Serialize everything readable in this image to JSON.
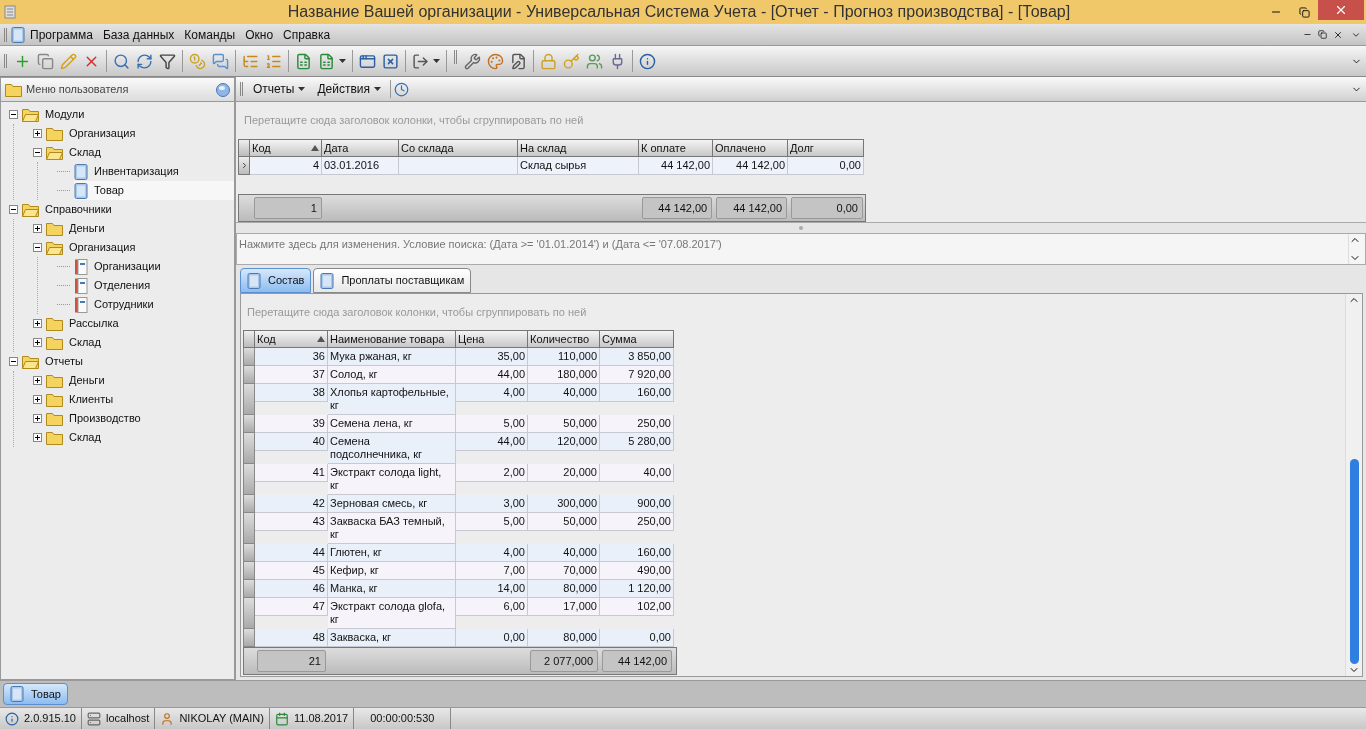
{
  "window": {
    "title": "Название Вашей организации - Универсальная Система Учета - [Отчет - Прогноз производства] - [Товар]"
  },
  "menu": [
    "Программа",
    "База данных",
    "Команды",
    "Окно",
    "Справка"
  ],
  "sidebar": {
    "title": "Меню пользователя",
    "tree": [
      {
        "label": "Модули",
        "kind": "folder",
        "expanded": true,
        "selected": false,
        "children": [
          {
            "label": "Организация",
            "kind": "folder",
            "expanded": false,
            "selected": false
          },
          {
            "label": "Склад",
            "kind": "folder",
            "expanded": true,
            "selected": false,
            "children": [
              {
                "label": "Инвентаризация",
                "kind": "form",
                "selected": false
              },
              {
                "label": "Товар",
                "kind": "form",
                "selected": true
              }
            ]
          }
        ]
      },
      {
        "label": "Справочники",
        "kind": "folder",
        "expanded": true,
        "selected": false,
        "children": [
          {
            "label": "Деньги",
            "kind": "folder",
            "expanded": false,
            "selected": false
          },
          {
            "label": "Организация",
            "kind": "folder",
            "expanded": true,
            "selected": false,
            "children": [
              {
                "label": "Организации",
                "kind": "list",
                "selected": false
              },
              {
                "label": "Отделения",
                "kind": "list",
                "selected": false
              },
              {
                "label": "Сотрудники",
                "kind": "list",
                "selected": false
              }
            ]
          },
          {
            "label": "Рассылка",
            "kind": "folder",
            "expanded": false,
            "selected": false
          },
          {
            "label": "Склад",
            "kind": "folder",
            "expanded": false,
            "selected": false
          }
        ]
      },
      {
        "label": "Отчеты",
        "kind": "folder",
        "expanded": true,
        "selected": false,
        "children": [
          {
            "label": "Деньги",
            "kind": "folder",
            "expanded": false,
            "selected": false
          },
          {
            "label": "Клиенты",
            "kind": "folder",
            "expanded": false,
            "selected": false
          },
          {
            "label": "Производство",
            "kind": "folder",
            "expanded": false,
            "selected": false
          },
          {
            "label": "Склад",
            "kind": "folder",
            "expanded": false,
            "selected": false
          }
        ]
      }
    ]
  },
  "report_toolbar": [
    "Отчеты",
    "Действия"
  ],
  "upper_grid": {
    "group_hint": "Перетащите сюда заголовок колонки, чтобы сгруппировать по ней",
    "columns": [
      {
        "label": "Код",
        "sorted": true
      },
      {
        "label": "Дата",
        "sorted": false
      },
      {
        "label": "Со склада",
        "sorted": false
      },
      {
        "label": "На склад",
        "sorted": false
      },
      {
        "label": "К оплате",
        "sorted": false
      },
      {
        "label": "Оплачено",
        "sorted": false
      },
      {
        "label": "Долг",
        "sorted": false
      }
    ],
    "rows": [
      {
        "selected": true,
        "cells": [
          "4",
          "03.01.2016",
          "",
          "Склад сырья",
          "44 142,00",
          "44 142,00",
          "0,00"
        ]
      }
    ],
    "totals": {
      "count": "1",
      "sums": [
        "44 142,00",
        "44 142,00",
        "0,00"
      ]
    }
  },
  "filter": "Нажмите здесь для изменения. Условие поиска: (Дата  >= '01.01.2014') и (Дата  <= '07.08.2017')",
  "tabs": [
    {
      "label": "Состав",
      "selected": true
    },
    {
      "label": "Проплаты поставщикам",
      "selected": false
    }
  ],
  "lower_grid": {
    "group_hint": "Перетащите сюда заголовок колонки, чтобы сгруппировать по ней",
    "columns": [
      {
        "label": "Код",
        "sorted": true
      },
      {
        "label": "Наименование товара",
        "sorted": false
      },
      {
        "label": "Цена",
        "sorted": false
      },
      {
        "label": "Количество",
        "sorted": false
      },
      {
        "label": "Сумма",
        "sorted": false
      }
    ],
    "rows": [
      [
        "36",
        "Мука ржаная, кг",
        "35,00",
        "110,000",
        "3 850,00"
      ],
      [
        "37",
        "Солод, кг",
        "44,00",
        "180,000",
        "7 920,00"
      ],
      [
        "38",
        "Хлопья картофельные, кг",
        "4,00",
        "40,000",
        "160,00"
      ],
      [
        "39",
        "Семена лена, кг",
        "5,00",
        "50,000",
        "250,00"
      ],
      [
        "40",
        "Семена подсолнечника, кг",
        "44,00",
        "120,000",
        "5 280,00"
      ],
      [
        "41",
        "Экстракт солода light, кг",
        "2,00",
        "20,000",
        "40,00"
      ],
      [
        "42",
        "Зерновая смесь, кг",
        "3,00",
        "300,000",
        "900,00"
      ],
      [
        "43",
        "Закваска БАЗ темный, кг",
        "5,00",
        "50,000",
        "250,00"
      ],
      [
        "44",
        "Глютен, кг",
        "4,00",
        "40,000",
        "160,00"
      ],
      [
        "45",
        "Кефир, кг",
        "7,00",
        "70,000",
        "490,00"
      ],
      [
        "46",
        "Манка, кг",
        "14,00",
        "80,000",
        "1 120,00"
      ],
      [
        "47",
        "Экстракт солода glofa, кг",
        "6,00",
        "17,000",
        "102,00"
      ],
      [
        "48",
        "Закваска, кг",
        "0,00",
        "80,000",
        "0,00"
      ]
    ],
    "totals": {
      "count": "21",
      "sums": [
        "2 077,000",
        "44 142,00"
      ]
    }
  },
  "taskbar": [
    {
      "label": "Товар",
      "selected": true
    }
  ],
  "status_bar": [
    {
      "kind": "version",
      "text": "2.0.915.10"
    },
    {
      "kind": "server",
      "text": "localhost"
    },
    {
      "kind": "user",
      "text": "NIKOLAY (MAIN)"
    },
    {
      "kind": "date",
      "text": "11.08.2017"
    },
    {
      "kind": "timer",
      "text": "00:00:00:530"
    }
  ]
}
